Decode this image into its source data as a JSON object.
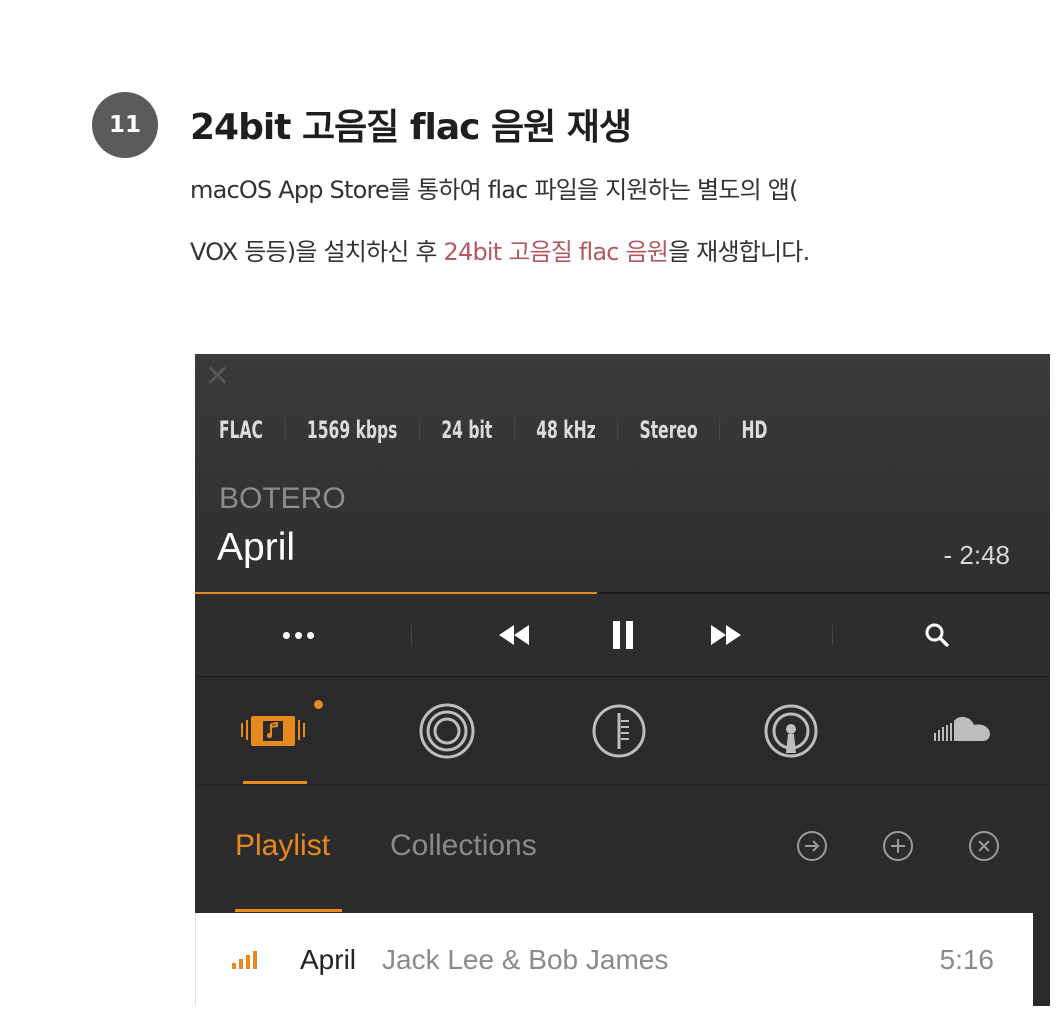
{
  "step": {
    "number": "11",
    "title": "24bit 고음질 flac 음원 재생",
    "desc_line1": "macOS App Store를 통하여 flac  파일을 지원하는 별도의 앱(",
    "desc_line2_pre": "VOX 등등)을 설치하신 후 ",
    "desc_line2_highlight": "24bit 고음질 flac 음원",
    "desc_line2_post": "을 재생합니다."
  },
  "player": {
    "close_icon": "close-icon",
    "meta": [
      "FLAC",
      "1569 kbps",
      "24 bit",
      "48 kHz",
      "Stereo",
      "HD"
    ],
    "artist": "BOTERO",
    "title": "April",
    "remaining": "- 2:48",
    "progress": 0.47,
    "more_label": "•••",
    "tabs": {
      "playlist": "Playlist",
      "collections": "Collections"
    },
    "playlist": [
      {
        "title": "April",
        "artist": "Jack Lee & Bob James",
        "duration": "5:16"
      }
    ],
    "colors": {
      "accent": "#e8891e",
      "highlight_text": "#b35a60"
    }
  }
}
